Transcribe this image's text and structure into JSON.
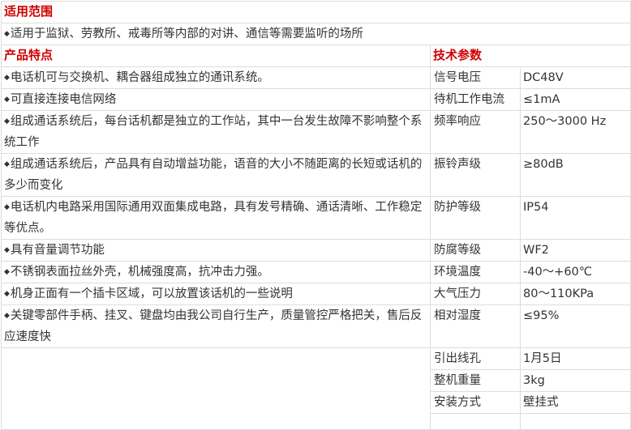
{
  "scope": {
    "heading": "适用范围",
    "text": "适用于监狱、劳教所、戒毒所等内部的对讲、通信等需要监听的场所"
  },
  "features": {
    "heading": "产品特点",
    "items": [
      "电话机可与交换机、耦合器组成独立的通讯系统。",
      "可直接连接电信网络",
      "组成通话系统后，每台话机都是独立的工作站，其中一台发生故障不影响整个系统工作",
      "组成通话系统后，产品具有自动增益功能，语音的大小不随距离的长短或话机的多少而变化",
      "电话机内电路采用国际通用双面集成电路，具有发号精确、通话清晰、工作稳定等优点。",
      "具有音量调节功能",
      "不锈钢表面拉丝外壳，机械强度高，抗冲击力强。",
      "机身正面有一个插卡区域，可以放置该话机的一些说明",
      "关键零部件手柄、挂叉、键盘均由我公司自行生产，质量管控严格把关，售后反应速度快"
    ]
  },
  "specs": {
    "heading": "技术参数",
    "rows": [
      {
        "label": "信号电压",
        "value": "DC48V"
      },
      {
        "label": "待机工作电流",
        "value": "≤1mA"
      },
      {
        "label": "频率响应",
        "value": "250～3000 Hz"
      },
      {
        "label": "振铃声级",
        "value": "≥80dB"
      },
      {
        "label": "防护等级",
        "value": "IP54"
      },
      {
        "label": "防腐等级",
        "value": "WF2"
      },
      {
        "label": "环境温度",
        "value": "-40～+60℃"
      },
      {
        "label": "大气压力",
        "value": "80～110KPa"
      },
      {
        "label": "相对湿度",
        "value": "≤95%"
      },
      {
        "label": "引出线孔",
        "value": "1月5日"
      },
      {
        "label": "整机重量",
        "value": "3kg"
      },
      {
        "label": "安装方式",
        "value": "壁挂式"
      }
    ]
  },
  "icons": {
    "bullet": "◆"
  }
}
